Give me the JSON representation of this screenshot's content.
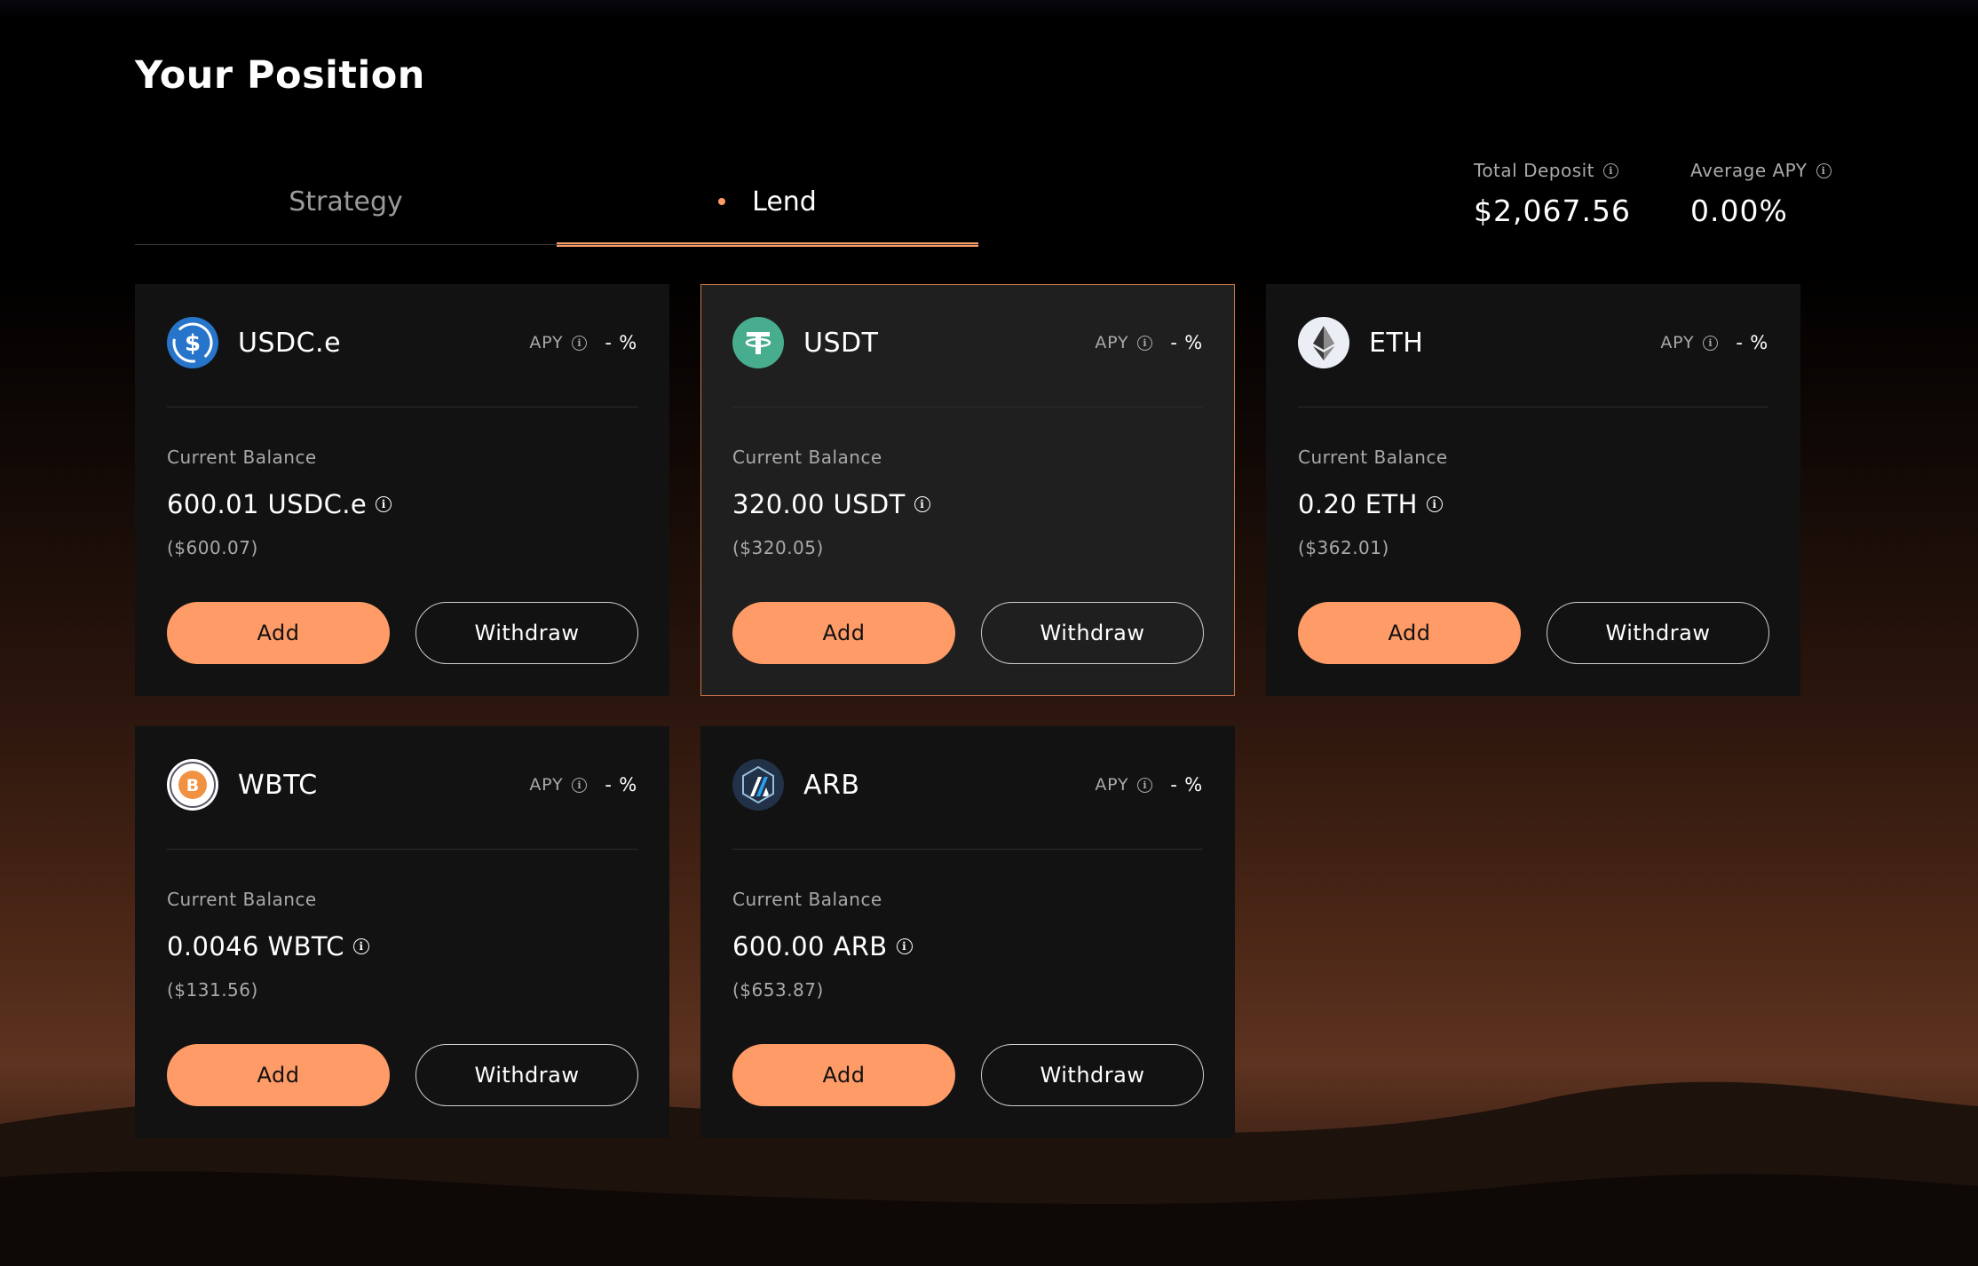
{
  "page": {
    "title": "Your Position"
  },
  "tabs": [
    {
      "label": "Strategy",
      "active": false
    },
    {
      "label": "Lend",
      "active": true
    }
  ],
  "stats": {
    "total_deposit": {
      "label": "Total Deposit",
      "value": "$2,067.56"
    },
    "average_apy": {
      "label": "Average APY",
      "value": "0.00%"
    }
  },
  "colors": {
    "accent": "#ff9b66",
    "card_bg": "#121212",
    "card_highlight_bg": "#1f1f1f",
    "highlight_border": "#c9764a"
  },
  "cards": [
    {
      "token": "USDC.e",
      "icon": "usdc-icon",
      "apy_label": "APY",
      "apy_value": "- %",
      "balance_label": "Current Balance",
      "balance": "600.01 USDC.e",
      "balance_usd": "($600.07)",
      "add_label": "Add",
      "withdraw_label": "Withdraw"
    },
    {
      "token": "USDT",
      "icon": "tether-icon",
      "apy_label": "APY",
      "apy_value": "- %",
      "balance_label": "Current Balance",
      "balance": "320.00 USDT",
      "balance_usd": "($320.05)",
      "add_label": "Add",
      "withdraw_label": "Withdraw",
      "highlighted": true
    },
    {
      "token": "ETH",
      "icon": "ethereum-icon",
      "apy_label": "APY",
      "apy_value": "- %",
      "balance_label": "Current Balance",
      "balance": "0.20 ETH",
      "balance_usd": "($362.01)",
      "add_label": "Add",
      "withdraw_label": "Withdraw"
    },
    {
      "token": "WBTC",
      "icon": "wbtc-icon",
      "apy_label": "APY",
      "apy_value": "- %",
      "balance_label": "Current Balance",
      "balance": "0.0046 WBTC",
      "balance_usd": "($131.56)",
      "add_label": "Add",
      "withdraw_label": "Withdraw"
    },
    {
      "token": "ARB",
      "icon": "arbitrum-icon",
      "apy_label": "APY",
      "apy_value": "- %",
      "balance_label": "Current Balance",
      "balance": "600.00 ARB",
      "balance_usd": "($653.87)",
      "add_label": "Add",
      "withdraw_label": "Withdraw"
    }
  ]
}
